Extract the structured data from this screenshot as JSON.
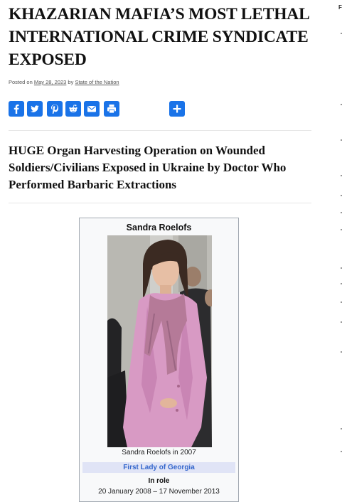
{
  "article": {
    "title": "KHAZARIAN MAFIA’S MOST LETHAL INTERNATIONAL CRIME SYNDICATE EXPOSED",
    "meta": {
      "posted_on": "Posted on",
      "date": "May 28, 2023",
      "by": "by",
      "author": "State of the Nation"
    },
    "share_buttons": [
      {
        "icon": "facebook-icon"
      },
      {
        "icon": "twitter-icon"
      },
      {
        "icon": "pinterest-icon"
      },
      {
        "icon": "reddit-icon"
      },
      {
        "icon": "email-icon"
      },
      {
        "icon": "print-icon"
      },
      {
        "icon": "share-plus-icon"
      }
    ],
    "subheading": "HUGE Organ Harvesting Operation on Wounded Soldiers/Civilians Exposed in Ukraine by Doctor Who Performed Barbaric Extractions",
    "infobox": {
      "name": "Sandra Roelofs",
      "caption": "Sandra Roelofs in 2007",
      "role": "First Lady of Georgia",
      "in_role_label": "In role",
      "dates": "20 January 2008 – 17 November 2013"
    }
  },
  "sidebar": {
    "heading": "F"
  },
  "colors": {
    "share_button": "#1a73e8",
    "role_band": "#e0e4f6",
    "role_text": "#3366cc",
    "infobox_bg": "#f8f9fa",
    "infobox_border": "#a2a9b1"
  }
}
